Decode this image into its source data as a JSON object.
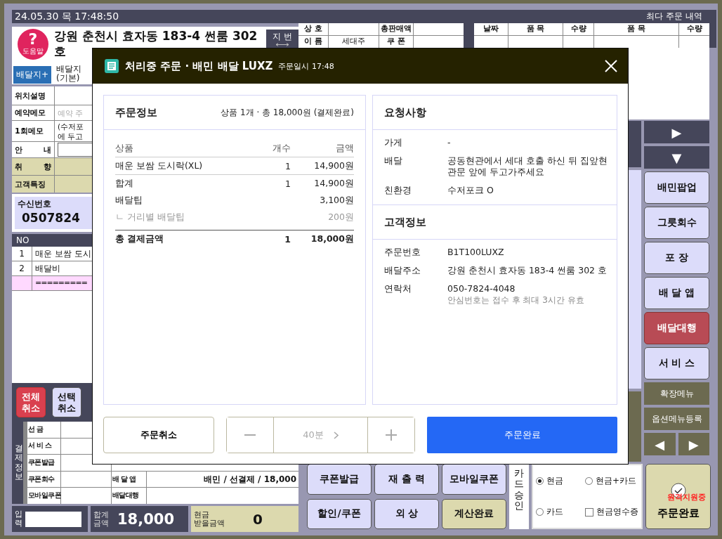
{
  "top_bar": {
    "datetime": "24.05.30 목 17:48:50",
    "title": "최다 주문 내역"
  },
  "customer": {
    "help_icon": "?",
    "help_label": "도움말",
    "address": "강원 춘천시 효자동 183-4 썬룸 302 호",
    "jibun_button": "지 번",
    "add_address_button": "배달지+",
    "address_label": "배달지\n(기본)"
  },
  "fields": [
    {
      "label": "위치설명",
      "kind": "plain"
    },
    {
      "label": "예약메모",
      "kind": "placeholder",
      "placeholder": "예약 주"
    },
    {
      "label": "1회메모",
      "kind": "text",
      "value": "(수저포\n에 두고"
    },
    {
      "label": "안 내",
      "kind": "input"
    },
    {
      "label": "취 향",
      "kind": "highlight"
    },
    {
      "label": "고객특징",
      "kind": "highlight"
    }
  ],
  "caller": {
    "label": "수신번호",
    "number": "0507824"
  },
  "items_table": {
    "column": "NO",
    "rows": [
      {
        "no": "1",
        "name": "매운 보쌈 도시",
        "kind": "item"
      },
      {
        "no": "2",
        "name": "배달비",
        "kind": "item"
      },
      {
        "name": "=========",
        "kind": "separator"
      }
    ]
  },
  "cancel_buttons": [
    {
      "label": "전체\n취소",
      "kind": "danger"
    },
    {
      "label": "선택\n취소",
      "kind": "normal"
    }
  ],
  "payment_info": {
    "title": "결제정보",
    "rows": [
      "선 금",
      "서 비 스",
      "쿠폰발급",
      "쿠폰회수",
      "모바일쿠폰"
    ],
    "app_rows": [
      {
        "label": "배 달 앱",
        "value": "배민 / 선결제 / 18,000"
      },
      {
        "label": "배달대행"
      }
    ]
  },
  "totals": {
    "input_label": "입력",
    "sum_label": "합계\n금액",
    "sum": "18,000",
    "cash_label": "현금\n받을금액",
    "cash": "0"
  },
  "shop_table": {
    "rows": [
      [
        {
          "label": "상 호"
        },
        {
          "label": "총판매액"
        }
      ],
      [
        {
          "label": "이 름",
          "value": "세대주"
        },
        {
          "label": "쿠 폰"
        }
      ]
    ]
  },
  "history_table": {
    "columns": [
      "날짜",
      "품 목",
      "수량",
      "품 목",
      "수량"
    ]
  },
  "side_buttons": [
    {
      "label": "▶",
      "kind": "nav"
    },
    {
      "label": "▼",
      "kind": "nav"
    },
    {
      "label": "배민팝업",
      "kind": "normal"
    },
    {
      "label": "그릇회수",
      "kind": "normal"
    },
    {
      "label": "포 장",
      "kind": "normal"
    },
    {
      "label": "배 달 앱",
      "kind": "normal"
    },
    {
      "label": "배달대행",
      "kind": "danger"
    },
    {
      "label": "서 비 스",
      "kind": "normal"
    },
    {
      "label": "확장메뉴",
      "kind": "menu"
    },
    {
      "label": "옵션메뉴등록",
      "kind": "menu"
    }
  ],
  "nav_buttons": [
    "◀",
    "▶"
  ],
  "action_buttons": [
    {
      "label": "쿠폰발급",
      "kind": "normal"
    },
    {
      "label": "재 출 력",
      "kind": "normal"
    },
    {
      "label": "모바일쿠폰",
      "kind": "normal"
    },
    {
      "label": "할인/쿠폰",
      "kind": "normal"
    },
    {
      "label": "외 상",
      "kind": "normal"
    },
    {
      "label": "계산완료",
      "kind": "accent"
    }
  ],
  "card_approval": "카드승인",
  "payment_methods": [
    {
      "label": "현금",
      "kind": "radio",
      "selected": true
    },
    {
      "label": "현금+카드",
      "kind": "radio",
      "selected": false
    },
    {
      "label": "카드",
      "kind": "radio",
      "selected": false
    },
    {
      "label": "현금영수증",
      "kind": "checkbox",
      "checked": false
    }
  ],
  "complete_button": "주문완료",
  "remote_badge": "원격지원중",
  "order_modal": {
    "title": "처리중 주문 · 배민 배달 LUXZ",
    "time": "주문일시 17:48",
    "order_info": {
      "title": "주문정보",
      "summary": "상품 1개 · 총 18,000원 (결제완료)",
      "columns": [
        "상품",
        "개수",
        "금액"
      ],
      "rows": [
        {
          "name": "매운 보쌈 도시락(XL)",
          "qty": "1",
          "amount": "14,900원",
          "kind": "item"
        },
        {
          "name": "합계",
          "qty": "1",
          "amount": "14,900원",
          "kind": "subtotal"
        },
        {
          "name": "배달팁",
          "amount": "3,100원",
          "kind": "fee"
        },
        {
          "name": "ㄴ 거리별 배달팁",
          "amount": "200원",
          "kind": "subfee"
        },
        {
          "name": "총 결제금액",
          "qty": "1",
          "amount": "18,000원",
          "kind": "total"
        }
      ]
    },
    "requests": {
      "title": "요청사항",
      "rows": [
        {
          "label": "가게",
          "value": "-"
        },
        {
          "label": "배달",
          "value": "공동현관에서 세대 호출 하신 뒤 집앞현관문 앞에 두고가주세요"
        },
        {
          "label": "친환경",
          "value": "수저포크 O"
        }
      ]
    },
    "customer_info": {
      "title": "고객정보",
      "rows": [
        {
          "label": "주문번호",
          "value": "B1T100LUXZ"
        },
        {
          "label": "배달주소",
          "value": "강원 춘천시 효자동 183-4 썬룸 302 호"
        },
        {
          "label": "연락처",
          "value": "050-7824-4048",
          "note": "안심번호는 접수 후 최대 3시간 유효"
        }
      ]
    },
    "cancel_button": "주문취소",
    "prep_time": "40분",
    "complete_button": "주문완료"
  }
}
